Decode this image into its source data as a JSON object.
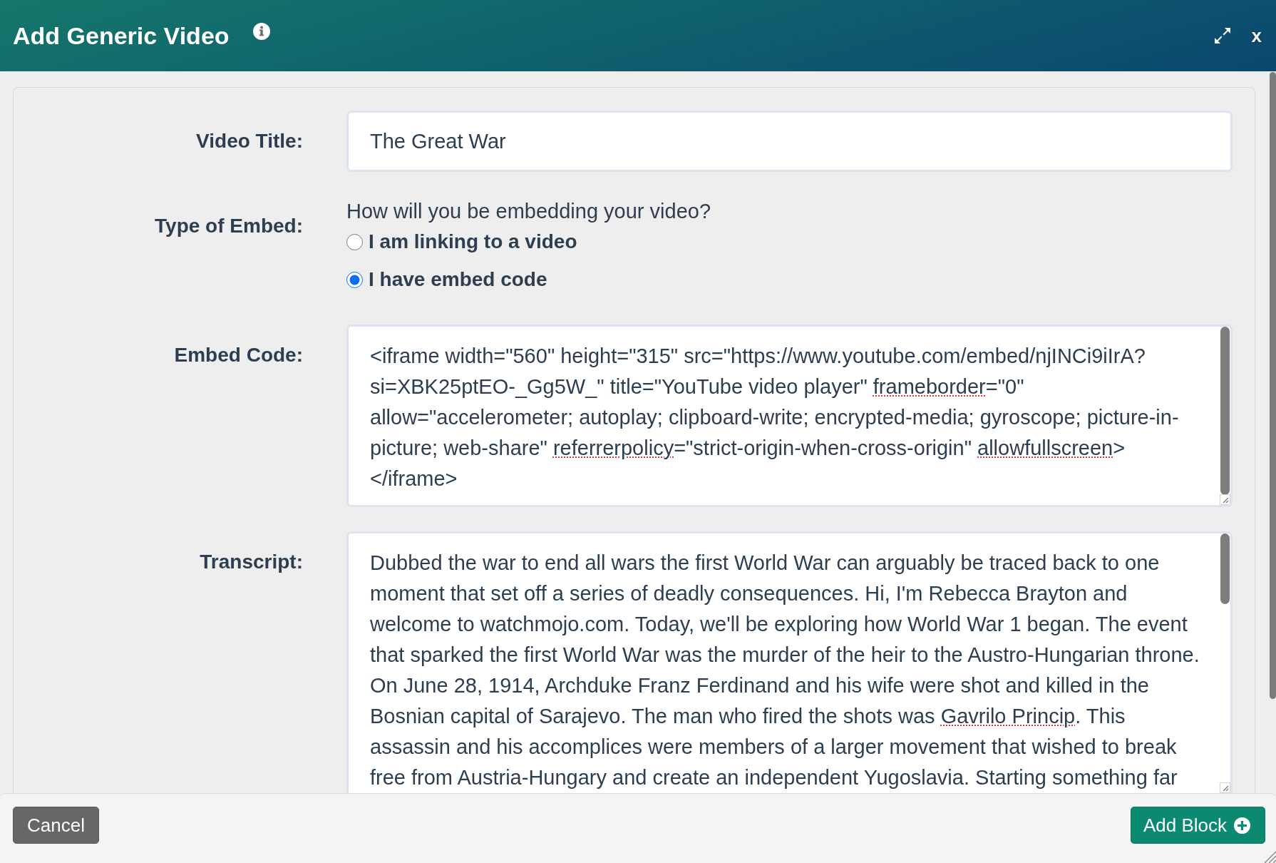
{
  "dialog": {
    "title": "Add Generic Video",
    "close_label": "x"
  },
  "fields": [
    {
      "kind": "text",
      "label": "Video Title:",
      "value": "The Great War"
    },
    {
      "kind": "choice",
      "label": "Type of Embed:",
      "prompt": "How will you be embedding your video?",
      "options": [
        {
          "label": "I am linking to a video",
          "selected": false
        },
        {
          "label": "I have embed code",
          "selected": true
        }
      ]
    },
    {
      "kind": "textarea",
      "label": "Embed Code:",
      "value_parts": [
        {
          "text": "<iframe width=\"560\" height=\"315\" src=\"https://www.youtube.com/embed/njINCi9iIrA?si=XBK25ptEO-_Gg5W_\" title=\"YouTube video player\" ",
          "misspelled": false
        },
        {
          "text": "frameborder",
          "misspelled": true
        },
        {
          "text": "=\"0\" allow=\"accelerometer; autoplay; clipboard-write; encrypted-media; gyroscope; picture-in-picture; web-share\" ",
          "misspelled": false
        },
        {
          "text": "referrerpolicy",
          "misspelled": true
        },
        {
          "text": "=\"strict-origin-when-cross-origin\" ",
          "misspelled": false
        },
        {
          "text": "allowfullscreen",
          "misspelled": true
        },
        {
          "text": "></iframe>",
          "misspelled": false
        }
      ]
    },
    {
      "kind": "textarea",
      "label": "Transcript:",
      "value_parts": [
        {
          "text": "Dubbed the war to end all wars the first World War can arguably be traced back to one moment that set off a series of deadly consequences. Hi, I'm Rebecca Brayton and welcome to watchmojo.com. Today, we'll be exploring how World War 1 began. The event that sparked the first World War was the murder of the heir to the Austro-Hungarian throne. On June 28, 1914, Archduke Franz Ferdinand and his wife were shot and killed in the Bosnian capital of Sarajevo. The man who fired the shots was ",
          "misspelled": false
        },
        {
          "text": "Gavrilo Princip",
          "misspelled": true
        },
        {
          "text": ". This assassin and his accomplices were members of a larger movement that wished to break free from Austria-Hungary and create an independent Yugoslavia. Starting something far",
          "misspelled": false
        }
      ]
    }
  ],
  "footer": {
    "buttons": [
      {
        "kind": "cancel",
        "label": "Cancel"
      },
      {
        "kind": "add",
        "label": "Add Block"
      }
    ]
  }
}
